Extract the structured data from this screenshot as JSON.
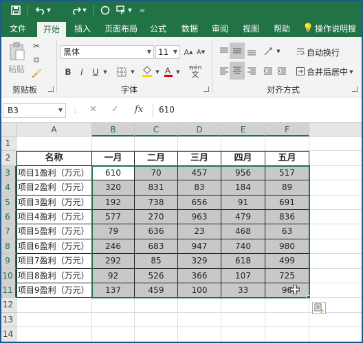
{
  "quick_access": {
    "save_icon": "save-icon",
    "undo_icon": "undo-icon",
    "redo_icon": "redo-icon",
    "shape_icon": "circle-icon",
    "touch_icon": "touch-mode-icon",
    "customize_icon": "customize-qat-icon"
  },
  "tabs": [
    "文件",
    "开始",
    "插入",
    "页面布局",
    "公式",
    "数据",
    "审阅",
    "视图",
    "帮助",
    "操作说明搜"
  ],
  "active_tab": "开始",
  "ribbon": {
    "clipboard": {
      "paste_label": "粘贴",
      "group_label": "剪贴板"
    },
    "font": {
      "font_name": "黑体",
      "font_size": "11",
      "bold": "B",
      "italic": "I",
      "underline": "U",
      "phonetic": "wén",
      "group_label": "字体"
    },
    "alignment": {
      "wrap_text": "自动换行",
      "merge_center": "合并后居中",
      "group_label": "对齐方式"
    }
  },
  "formula_bar": {
    "name_box": "B3",
    "cancel": "✕",
    "enter": "✓",
    "fx": "fx",
    "value": "610"
  },
  "sheet": {
    "columns": [
      "A",
      "B",
      "C",
      "D",
      "E",
      "F"
    ],
    "rows": [
      "1",
      "2",
      "3",
      "4",
      "5",
      "6",
      "7",
      "8",
      "9",
      "10",
      "11",
      "12",
      "13",
      "14"
    ],
    "header_row": [
      "名称",
      "一月",
      "二月",
      "三月",
      "四月",
      "五月"
    ],
    "data_rows": [
      [
        "项目1盈利（万元）",
        "610",
        "70",
        "457",
        "956",
        "517"
      ],
      [
        "项目2盈利（万元）",
        "320",
        "831",
        "83",
        "184",
        "89"
      ],
      [
        "项目3盈利（万元）",
        "192",
        "738",
        "656",
        "91",
        "691"
      ],
      [
        "项目4盈利（万元）",
        "577",
        "270",
        "963",
        "479",
        "836"
      ],
      [
        "项目5盈利（万元）",
        "79",
        "636",
        "23",
        "468",
        "63"
      ],
      [
        "项目6盈利（万元）",
        "246",
        "683",
        "947",
        "740",
        "980"
      ],
      [
        "项目7盈利（万元）",
        "292",
        "85",
        "329",
        "618",
        "499"
      ],
      [
        "项目8盈利（万元）",
        "92",
        "526",
        "366",
        "107",
        "725"
      ],
      [
        "项目9盈利（万元）",
        "137",
        "459",
        "100",
        "33",
        "96"
      ]
    ],
    "active_cell": "B3",
    "selection_range": "B3:F11"
  },
  "colors": {
    "accent": "#217346",
    "selection_fill": "#c8c8c8"
  }
}
